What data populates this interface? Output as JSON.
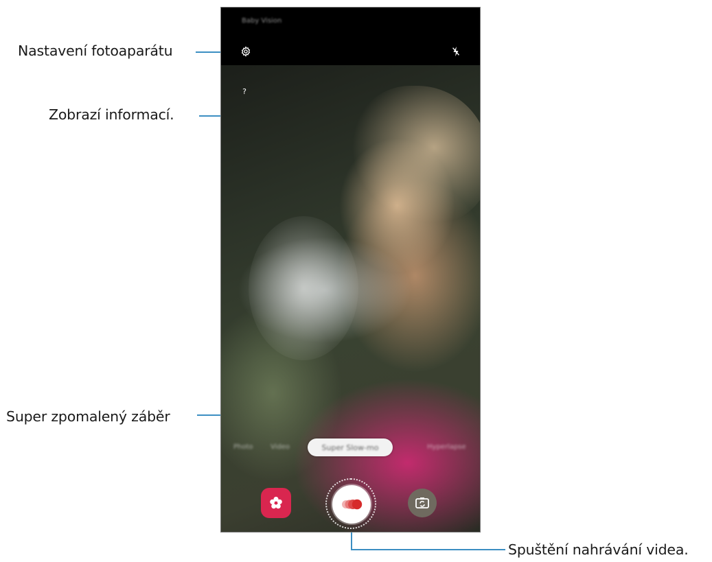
{
  "callouts": {
    "settings": "Nastavení fotoaparátu",
    "info": "Zobrazí informací.",
    "mode": "Super zpomalený záběr",
    "record": "Spuštění nahrávání videa."
  },
  "phone": {
    "status_text": "Baby Vision",
    "info_glyph": "?",
    "modes": {
      "left1": "Photo",
      "left2": "Video",
      "current": "Super Slow-mo",
      "right1": "Hyperlapse"
    }
  },
  "colors": {
    "callout_line": "#3b8ec2",
    "bixby_button": "#d9264f",
    "record_dot": "#d62b2b",
    "switch_button": "#6f6a5f"
  },
  "icons": {
    "settings": "gear-icon",
    "flash": "flash-off-icon",
    "info": "help-icon",
    "filters": "flower-icon",
    "record": "slow-motion-record-icon",
    "switch_camera": "switch-camera-icon"
  }
}
